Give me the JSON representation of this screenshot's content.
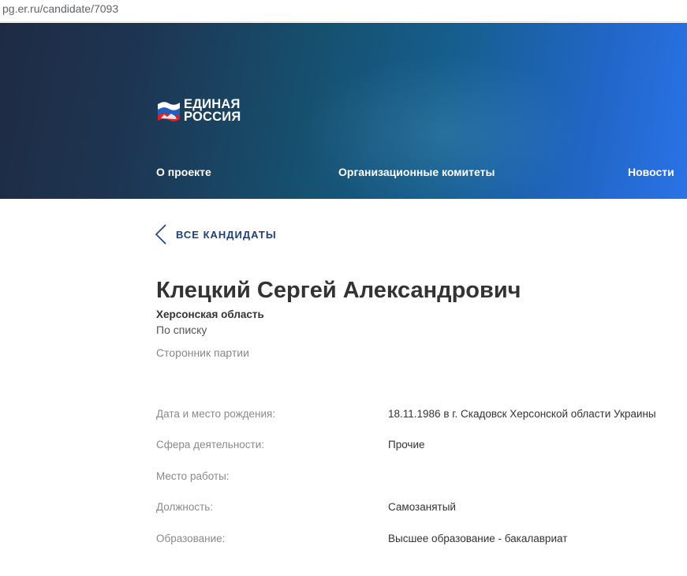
{
  "browser": {
    "url": "pg.er.ru/candidate/7093"
  },
  "header": {
    "logo_line1": "ЕДИНАЯ",
    "logo_line2": "РОССИЯ",
    "nav": [
      "О проекте",
      "Организационные комитеты",
      "Новости"
    ]
  },
  "back_link": {
    "label": "ВСЕ КАНДИДАТЫ"
  },
  "candidate": {
    "name": "Клецкий Сергей Александрович",
    "region": "Херсонская область",
    "list_type": "По списку",
    "status": "Сторонник партии"
  },
  "details": [
    {
      "label": "Дата и место рождения:",
      "value": "18.11.1986 в г. Скадовск Херсонской области Украины"
    },
    {
      "label": "Сфера деятельности:",
      "value": "Прочие"
    },
    {
      "label": "Место работы:",
      "value": ""
    },
    {
      "label": "Должность:",
      "value": "Самозанятый"
    },
    {
      "label": "Образование:",
      "value": "Высшее образование - бакалавриат"
    }
  ],
  "colors": {
    "brand_blue": "#1d3f7a",
    "flag_white": "#ffffff",
    "flag_blue": "#1f5fbf",
    "flag_red": "#d8232a"
  }
}
